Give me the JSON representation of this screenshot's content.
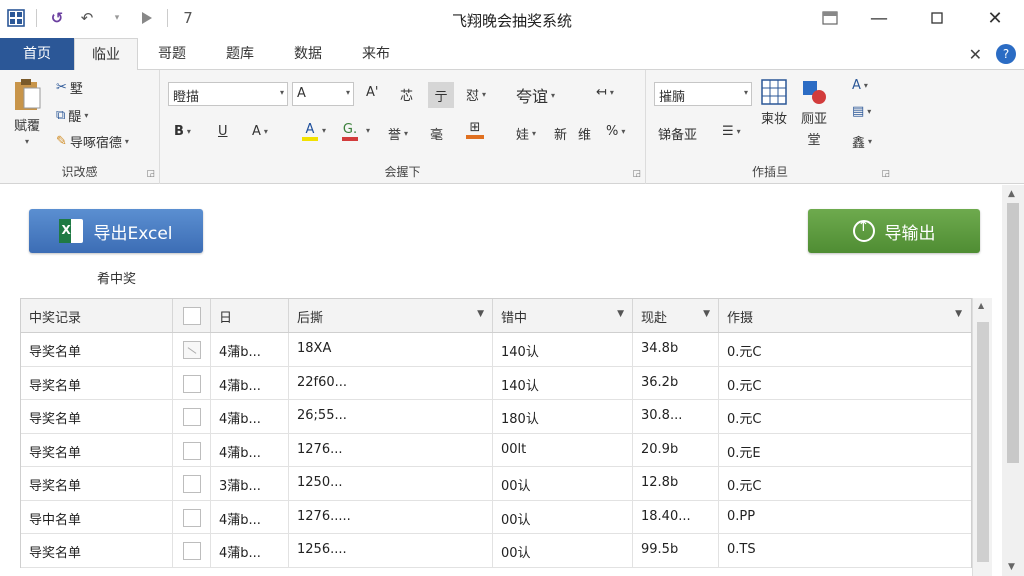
{
  "window": {
    "title": "飞翔晚会抽奖系统",
    "qat_extra": "7"
  },
  "tabs": [
    {
      "label": "首页",
      "kind": "file"
    },
    {
      "label": "临业",
      "kind": "active"
    },
    {
      "label": "哥题",
      "kind": "normal"
    },
    {
      "label": "题库",
      "kind": "normal"
    },
    {
      "label": "数据",
      "kind": "normal"
    },
    {
      "label": "来布",
      "kind": "normal"
    }
  ],
  "ribbon": {
    "group1": {
      "label": "识改感",
      "big_button": "赋覆",
      "items": [
        "墅",
        "醍",
        "导啄宿德"
      ]
    },
    "group2": {
      "label": "会握下",
      "font_combo": "瞪描",
      "size_combo": "A",
      "row1": [
        "A'",
        "芯",
        "亍",
        "怼",
        "夸谊"
      ],
      "row2": [
        "B",
        "U",
        "A",
        "A",
        "G.",
        "誉",
        "毫",
        "娃",
        "新",
        "维",
        "%"
      ]
    },
    "group3": {
      "label": "作插旦",
      "combo": "摧腩",
      "row2_text": "锑备亚",
      "big1": "柬妆",
      "big2": "厕亚",
      "big2_sub": "堂",
      "right_items": [
        "鑫"
      ]
    }
  },
  "content": {
    "export_button": "导出Excel",
    "output_button": "导输出",
    "subcaption": "肴中奖"
  },
  "table": {
    "headers": [
      "中奖记录",
      "",
      "日",
      "后撕",
      "错中",
      "现赴",
      "作摄"
    ],
    "rows": [
      {
        "c0": "导奖名单",
        "checked": true,
        "c2": "4蒲b...",
        "c3": "18XA",
        "c4": "140认",
        "c5": "34.8b",
        "c6": "0.元C"
      },
      {
        "c0": "导奖名单",
        "checked": false,
        "c2": "4蒲b...",
        "c3": "22f60...",
        "c4": "140认",
        "c5": "36.2b",
        "c6": "0.元C"
      },
      {
        "c0": "导奖名单",
        "checked": false,
        "c2": "4蒲b...",
        "c3": "26;55...",
        "c4": "180认",
        "c5": "30.8...",
        "c6": "0.元C"
      },
      {
        "c0": "导奖名单",
        "checked": false,
        "c2": "4蒲b...",
        "c3": "1276...",
        "c4": "00lt",
        "c5": "20.9b",
        "c6": "0.元E"
      },
      {
        "c0": "导奖名单",
        "checked": false,
        "c2": "3蒲b...",
        "c3": "1250...",
        "c4": "00认",
        "c5": "12.8b",
        "c6": "0.元C"
      },
      {
        "c0": "导中名单",
        "checked": false,
        "c2": "4蒲b...",
        "c3": "1276.....",
        "c4": "00认",
        "c5": "18.40...",
        "c6": "0.PP"
      },
      {
        "c0": "导奖名单",
        "checked": false,
        "c2": "4蒲b...",
        "c3": "1256....",
        "c4": "00认",
        "c5": "99.5b",
        "c6": "0.TS"
      }
    ]
  },
  "colors": {
    "file_tab": "#2b5797",
    "export_button": "#4a7cc4",
    "output_button": "#5b9a3e"
  }
}
